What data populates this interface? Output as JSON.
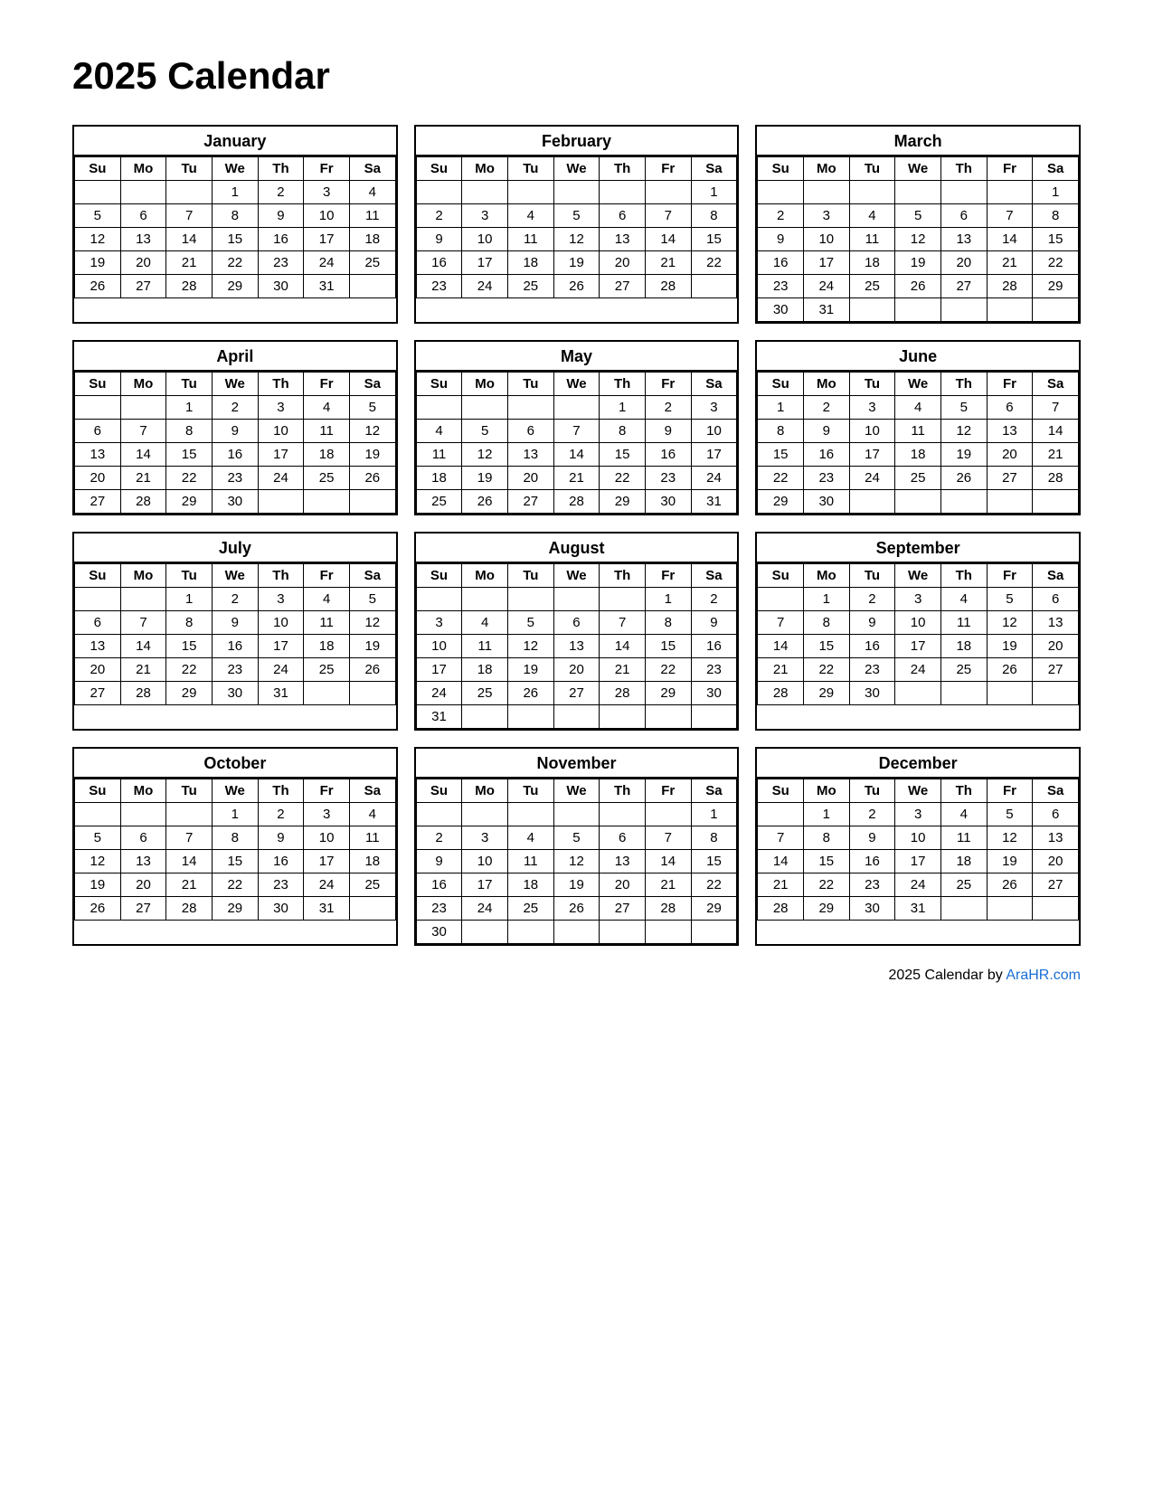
{
  "title": "2025 Calendar",
  "footer": {
    "text": "2025  Calendar by ",
    "link_label": "AraHR.com",
    "link_url": "AraHR.com"
  },
  "months": [
    {
      "name": "January",
      "days": [
        "Su",
        "Mo",
        "Tu",
        "We",
        "Th",
        "Fr",
        "Sa"
      ],
      "weeks": [
        [
          "",
          "",
          "",
          "1",
          "2",
          "3",
          "4"
        ],
        [
          "5",
          "6",
          "7",
          "8",
          "9",
          "10",
          "11"
        ],
        [
          "12",
          "13",
          "14",
          "15",
          "16",
          "17",
          "18"
        ],
        [
          "19",
          "20",
          "21",
          "22",
          "23",
          "24",
          "25"
        ],
        [
          "26",
          "27",
          "28",
          "29",
          "30",
          "31",
          ""
        ]
      ]
    },
    {
      "name": "February",
      "days": [
        "Su",
        "Mo",
        "Tu",
        "We",
        "Th",
        "Fr",
        "Sa"
      ],
      "weeks": [
        [
          "",
          "",
          "",
          "",
          "",
          "",
          "1"
        ],
        [
          "2",
          "3",
          "4",
          "5",
          "6",
          "7",
          "8"
        ],
        [
          "9",
          "10",
          "11",
          "12",
          "13",
          "14",
          "15"
        ],
        [
          "16",
          "17",
          "18",
          "19",
          "20",
          "21",
          "22"
        ],
        [
          "23",
          "24",
          "25",
          "26",
          "27",
          "28",
          ""
        ]
      ]
    },
    {
      "name": "March",
      "days": [
        "Su",
        "Mo",
        "Tu",
        "We",
        "Th",
        "Fr",
        "Sa"
      ],
      "weeks": [
        [
          "",
          "",
          "",
          "",
          "",
          "",
          "1"
        ],
        [
          "2",
          "3",
          "4",
          "5",
          "6",
          "7",
          "8"
        ],
        [
          "9",
          "10",
          "11",
          "12",
          "13",
          "14",
          "15"
        ],
        [
          "16",
          "17",
          "18",
          "19",
          "20",
          "21",
          "22"
        ],
        [
          "23",
          "24",
          "25",
          "26",
          "27",
          "28",
          "29"
        ],
        [
          "30",
          "31",
          "",
          "",
          "",
          "",
          ""
        ]
      ]
    },
    {
      "name": "April",
      "days": [
        "Su",
        "Mo",
        "Tu",
        "We",
        "Th",
        "Fr",
        "Sa"
      ],
      "weeks": [
        [
          "",
          "",
          "1",
          "2",
          "3",
          "4",
          "5"
        ],
        [
          "6",
          "7",
          "8",
          "9",
          "10",
          "11",
          "12"
        ],
        [
          "13",
          "14",
          "15",
          "16",
          "17",
          "18",
          "19"
        ],
        [
          "20",
          "21",
          "22",
          "23",
          "24",
          "25",
          "26"
        ],
        [
          "27",
          "28",
          "29",
          "30",
          "",
          "",
          ""
        ]
      ]
    },
    {
      "name": "May",
      "days": [
        "Su",
        "Mo",
        "Tu",
        "We",
        "Th",
        "Fr",
        "Sa"
      ],
      "weeks": [
        [
          "",
          "",
          "",
          "",
          "1",
          "2",
          "3"
        ],
        [
          "4",
          "5",
          "6",
          "7",
          "8",
          "9",
          "10"
        ],
        [
          "11",
          "12",
          "13",
          "14",
          "15",
          "16",
          "17"
        ],
        [
          "18",
          "19",
          "20",
          "21",
          "22",
          "23",
          "24"
        ],
        [
          "25",
          "26",
          "27",
          "28",
          "29",
          "30",
          "31"
        ]
      ]
    },
    {
      "name": "June",
      "days": [
        "Su",
        "Mo",
        "Tu",
        "We",
        "Th",
        "Fr",
        "Sa"
      ],
      "weeks": [
        [
          "1",
          "2",
          "3",
          "4",
          "5",
          "6",
          "7"
        ],
        [
          "8",
          "9",
          "10",
          "11",
          "12",
          "13",
          "14"
        ],
        [
          "15",
          "16",
          "17",
          "18",
          "19",
          "20",
          "21"
        ],
        [
          "22",
          "23",
          "24",
          "25",
          "26",
          "27",
          "28"
        ],
        [
          "29",
          "30",
          "",
          "",
          "",
          "",
          ""
        ]
      ]
    },
    {
      "name": "July",
      "days": [
        "Su",
        "Mo",
        "Tu",
        "We",
        "Th",
        "Fr",
        "Sa"
      ],
      "weeks": [
        [
          "",
          "",
          "1",
          "2",
          "3",
          "4",
          "5"
        ],
        [
          "6",
          "7",
          "8",
          "9",
          "10",
          "11",
          "12"
        ],
        [
          "13",
          "14",
          "15",
          "16",
          "17",
          "18",
          "19"
        ],
        [
          "20",
          "21",
          "22",
          "23",
          "24",
          "25",
          "26"
        ],
        [
          "27",
          "28",
          "29",
          "30",
          "31",
          "",
          ""
        ]
      ]
    },
    {
      "name": "August",
      "days": [
        "Su",
        "Mo",
        "Tu",
        "We",
        "Th",
        "Fr",
        "Sa"
      ],
      "weeks": [
        [
          "",
          "",
          "",
          "",
          "",
          "1",
          "2"
        ],
        [
          "3",
          "4",
          "5",
          "6",
          "7",
          "8",
          "9"
        ],
        [
          "10",
          "11",
          "12",
          "13",
          "14",
          "15",
          "16"
        ],
        [
          "17",
          "18",
          "19",
          "20",
          "21",
          "22",
          "23"
        ],
        [
          "24",
          "25",
          "26",
          "27",
          "28",
          "29",
          "30"
        ],
        [
          "31",
          "",
          "",
          "",
          "",
          "",
          ""
        ]
      ]
    },
    {
      "name": "September",
      "days": [
        "Su",
        "Mo",
        "Tu",
        "We",
        "Th",
        "Fr",
        "Sa"
      ],
      "weeks": [
        [
          "",
          "1",
          "2",
          "3",
          "4",
          "5",
          "6"
        ],
        [
          "7",
          "8",
          "9",
          "10",
          "11",
          "12",
          "13"
        ],
        [
          "14",
          "15",
          "16",
          "17",
          "18",
          "19",
          "20"
        ],
        [
          "21",
          "22",
          "23",
          "24",
          "25",
          "26",
          "27"
        ],
        [
          "28",
          "29",
          "30",
          "",
          "",
          "",
          ""
        ]
      ]
    },
    {
      "name": "October",
      "days": [
        "Su",
        "Mo",
        "Tu",
        "We",
        "Th",
        "Fr",
        "Sa"
      ],
      "weeks": [
        [
          "",
          "",
          "",
          "1",
          "2",
          "3",
          "4"
        ],
        [
          "5",
          "6",
          "7",
          "8",
          "9",
          "10",
          "11"
        ],
        [
          "12",
          "13",
          "14",
          "15",
          "16",
          "17",
          "18"
        ],
        [
          "19",
          "20",
          "21",
          "22",
          "23",
          "24",
          "25"
        ],
        [
          "26",
          "27",
          "28",
          "29",
          "30",
          "31",
          ""
        ]
      ]
    },
    {
      "name": "November",
      "days": [
        "Su",
        "Mo",
        "Tu",
        "We",
        "Th",
        "Fr",
        "Sa"
      ],
      "weeks": [
        [
          "",
          "",
          "",
          "",
          "",
          "",
          "1"
        ],
        [
          "2",
          "3",
          "4",
          "5",
          "6",
          "7",
          "8"
        ],
        [
          "9",
          "10",
          "11",
          "12",
          "13",
          "14",
          "15"
        ],
        [
          "16",
          "17",
          "18",
          "19",
          "20",
          "21",
          "22"
        ],
        [
          "23",
          "24",
          "25",
          "26",
          "27",
          "28",
          "29"
        ],
        [
          "30",
          "",
          "",
          "",
          "",
          "",
          ""
        ]
      ]
    },
    {
      "name": "December",
      "days": [
        "Su",
        "Mo",
        "Tu",
        "We",
        "Th",
        "Fr",
        "Sa"
      ],
      "weeks": [
        [
          "",
          "1",
          "2",
          "3",
          "4",
          "5",
          "6"
        ],
        [
          "7",
          "8",
          "9",
          "10",
          "11",
          "12",
          "13"
        ],
        [
          "14",
          "15",
          "16",
          "17",
          "18",
          "19",
          "20"
        ],
        [
          "21",
          "22",
          "23",
          "24",
          "25",
          "26",
          "27"
        ],
        [
          "28",
          "29",
          "30",
          "31",
          "",
          "",
          ""
        ]
      ]
    }
  ]
}
